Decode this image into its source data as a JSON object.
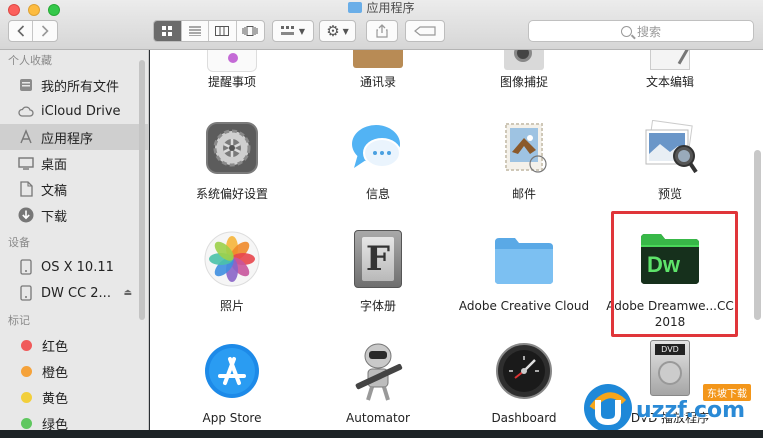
{
  "window": {
    "title": "应用程序"
  },
  "toolbar": {
    "search_placeholder": "搜索"
  },
  "sidebar": {
    "favorites_header": "个人收藏",
    "favorites": [
      {
        "label": "我的所有文件",
        "icon": "all-files-icon"
      },
      {
        "label": "iCloud Drive",
        "icon": "cloud-icon"
      },
      {
        "label": "应用程序",
        "icon": "applications-icon"
      },
      {
        "label": "桌面",
        "icon": "desktop-icon"
      },
      {
        "label": "文稿",
        "icon": "documents-icon"
      },
      {
        "label": "下载",
        "icon": "download-icon"
      }
    ],
    "devices_header": "设备",
    "devices": [
      {
        "label": "OS X 10.11",
        "icon": "disk-icon"
      },
      {
        "label": "DW CC 2...",
        "icon": "disk-icon"
      }
    ],
    "tags_header": "标记",
    "tags": [
      {
        "label": "红色",
        "color": "#f05a5a"
      },
      {
        "label": "橙色",
        "color": "#f5a23a"
      },
      {
        "label": "黄色",
        "color": "#f2cf3b"
      },
      {
        "label": "绿色",
        "color": "#5fc75f"
      }
    ]
  },
  "apps": {
    "top_row": [
      "提醒事项",
      "通讯录",
      "图像捕捉",
      "文本编辑"
    ],
    "row1": [
      "系统偏好设置",
      "信息",
      "邮件",
      "预览"
    ],
    "row2": [
      "照片",
      "字体册",
      "Adobe Creative Cloud",
      "Adobe Dreamwe...CC 2018"
    ],
    "row3": [
      "App Store",
      "Automator",
      "Dashboard",
      "DVD 播放程序"
    ]
  },
  "icon_text": {
    "font_book": "F",
    "dw": "Dw",
    "dvd": "DVD"
  },
  "watermark": {
    "brand": "uzzf.com",
    "badge": "东坡下载"
  }
}
